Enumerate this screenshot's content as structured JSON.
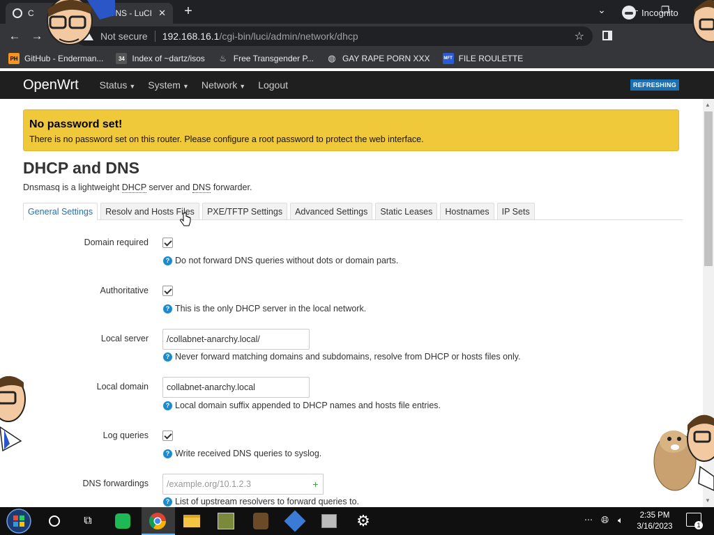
{
  "browser": {
    "tab_title": "DNS - LuCI",
    "tab_title_prefix": "C",
    "new_tab": "+",
    "omnibox": {
      "security": "Not secure",
      "host": "192.168.16.1",
      "path": "/cgi-bin/luci/admin/network/dhcp"
    },
    "profile": "Incognito"
  },
  "bookmarks": [
    {
      "label": "GitHub - Enderman...",
      "icon": "PH",
      "icon_color": "#f7941d"
    },
    {
      "label": "Index of ~dartz/isos",
      "icon": "34",
      "icon_color": "#444"
    },
    {
      "label": "Free Transgender P...",
      "icon": "flame-icon",
      "icon_color": "#ddd"
    },
    {
      "label": "GAY RAPE PORN XXX",
      "icon": "globe-icon",
      "icon_color": "#ddd"
    },
    {
      "label": "FILE ROULETTE",
      "icon": "MFT",
      "icon_color": "#2a5bd7"
    }
  ],
  "openwrt": {
    "brand": "OpenWrt",
    "menu": [
      "Status",
      "System",
      "Network",
      "Logout"
    ],
    "badge": "REFRESHING"
  },
  "alert": {
    "title": "No password set!",
    "message": "There is no password set on this router. Please configure a root password to protect the web interface."
  },
  "page": {
    "title": "DHCP and DNS",
    "desc_pre": "Dnsmasq is a lightweight ",
    "desc_abbr1": "DHCP",
    "desc_mid": " server and ",
    "desc_abbr2": "DNS",
    "desc_post": " forwarder."
  },
  "tabs": [
    "General Settings",
    "Resolv and Hosts Files",
    "PXE/TFTP Settings",
    "Advanced Settings",
    "Static Leases",
    "Hostnames",
    "IP Sets"
  ],
  "form": {
    "domain_required": {
      "label": "Domain required",
      "checked": true,
      "help": "Do not forward DNS queries without dots or domain parts."
    },
    "authoritative": {
      "label": "Authoritative",
      "checked": true,
      "help": "This is the only DHCP server in the local network."
    },
    "local_server": {
      "label": "Local server",
      "value": "/collabnet-anarchy.local/",
      "help": "Never forward matching domains and subdomains, resolve from DHCP or hosts files only."
    },
    "local_domain": {
      "label": "Local domain",
      "value": "collabnet-anarchy.local",
      "help": "Local domain suffix appended to DHCP names and hosts file entries."
    },
    "log_queries": {
      "label": "Log queries",
      "checked": true,
      "help": "Write received DNS queries to syslog."
    },
    "dns_forwardings": {
      "label": "DNS forwardings",
      "placeholder": "/example.org/10.1.2.3",
      "add": "+",
      "help": "List of upstream resolvers to forward queries to."
    }
  },
  "taskbar": {
    "time": "2:35 PM",
    "date": "3/16/2023",
    "notifications": "1"
  }
}
